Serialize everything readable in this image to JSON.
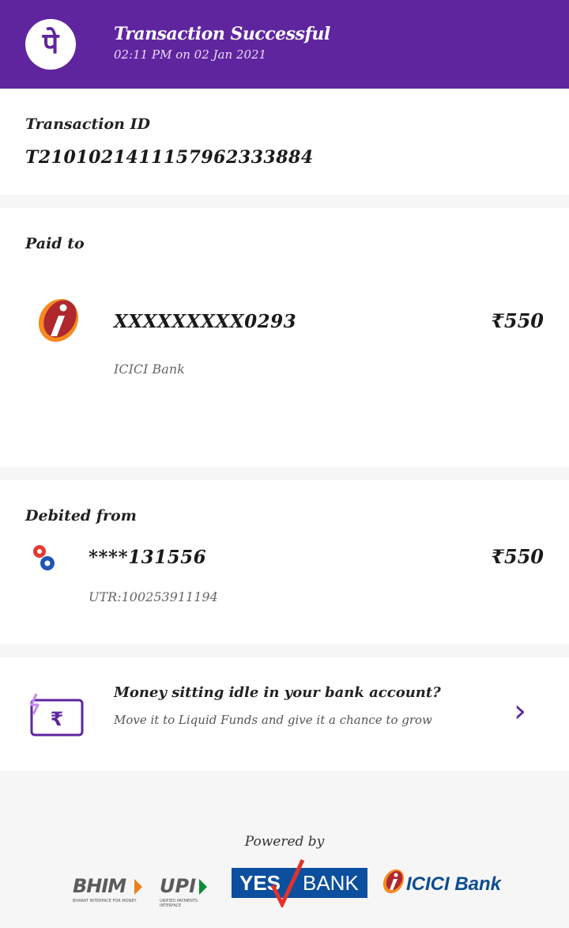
{
  "header": {
    "title": "Transaction Successful",
    "subtitle": "02:11 PM on 02 Jan 2021",
    "brand_color": "#5f259f",
    "logo_glyph": "पे"
  },
  "transaction": {
    "label": "Transaction ID",
    "id": "T2101021411157962333884"
  },
  "paid_to": {
    "label": "Paid to",
    "account": "XXXXXXXXX0293",
    "bank": "ICICI Bank",
    "amount": "₹550"
  },
  "debited_from": {
    "label": "Debited from",
    "account": "****131556",
    "utr": "UTR:100253911194",
    "amount": "₹550"
  },
  "promo": {
    "title": "Money sitting idle in your bank account?",
    "subtitle": "Move it to Liquid Funds and give it a chance to grow",
    "chevron": "›"
  },
  "footer": {
    "powered_by": "Powered by",
    "bhim_text": "BHIM",
    "bhim_tag": "BHARAT INTERFACE FOR MONEY",
    "upi_text": "UPI",
    "upi_tag": "UNIFIED PAYMENTS INTERFACE",
    "yes_bank_text1": "YES",
    "yes_bank_text2": "BANK",
    "icici_text": "ICICI Bank"
  }
}
